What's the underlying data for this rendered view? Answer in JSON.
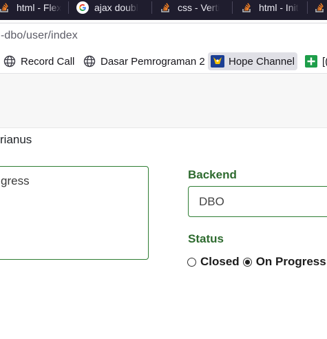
{
  "tabs": [
    {
      "label": "html - Flex",
      "icon": "stackoverflow-icon"
    },
    {
      "label": "ajax doubl",
      "icon": "google-icon"
    },
    {
      "label": "css - Verti",
      "icon": "stackoverflow-icon"
    },
    {
      "label": "html - Init",
      "icon": "stackoverflow-icon"
    },
    {
      "label": "",
      "icon": "stackoverflow-icon"
    }
  ],
  "address": {
    "url": "-dbo/user/index"
  },
  "bookmarks": [
    {
      "label": "Record Call",
      "icon": "globe-icon"
    },
    {
      "label": "Dasar Pemrograman 2",
      "icon": "globe-icon"
    },
    {
      "label": "Hope Channel",
      "icon": "hope-channel-icon"
    },
    {
      "label": "[(",
      "icon": "green-plus-icon"
    }
  ],
  "form": {
    "owner_text": "rianus",
    "notes_text": "gress",
    "backend_label": "Backend",
    "backend_value": "DBO",
    "status_label": "Status",
    "status_options": [
      {
        "label": "Closed",
        "checked": false
      },
      {
        "label": "On Progress",
        "checked": true
      }
    ]
  },
  "colors": {
    "tabstrip_bg": "#1f1d2e",
    "accent_green": "#2e7d32",
    "label_green": "#2e6b2f"
  }
}
